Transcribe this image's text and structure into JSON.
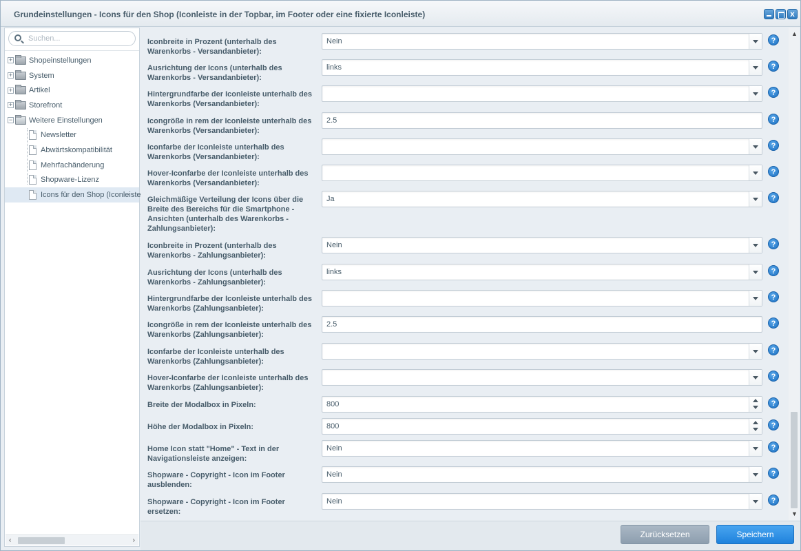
{
  "window": {
    "title": "Grundeinstellungen - Icons für den Shop (Iconleiste in der Topbar, im Footer oder eine fixierte Iconleiste)",
    "close_glyph": "x"
  },
  "sidebar": {
    "search_placeholder": "Suchen...",
    "expand_glyph": "+",
    "collapse_glyph": "−",
    "tree": [
      {
        "label": "Shopeinstellungen",
        "icon": "folder-icon",
        "expanded": false
      },
      {
        "label": "System",
        "icon": "folder-icon",
        "expanded": false
      },
      {
        "label": "Artikel",
        "icon": "folder-icon",
        "expanded": false
      },
      {
        "label": "Storefront",
        "icon": "folder-icon",
        "expanded": false
      },
      {
        "label": "Weitere Einstellungen",
        "icon": "folder-open-icon",
        "expanded": true
      },
      {
        "label": "Newsletter",
        "icon": "document-icon"
      },
      {
        "label": "Abwärtskompatibilität",
        "icon": "document-icon"
      },
      {
        "label": "Mehrfachänderung",
        "icon": "document-icon"
      },
      {
        "label": "Shopware-Lizenz",
        "icon": "document-icon"
      },
      {
        "label": "Icons für den Shop (Iconleiste",
        "icon": "document-icon",
        "selected": true
      }
    ]
  },
  "form": {
    "help_glyph": "?",
    "fields": [
      {
        "label": "Iconbreite in Prozent (unterhalb des Warenkorbs - Versandanbieter):",
        "type": "select",
        "value": "Nein"
      },
      {
        "label": "Ausrichtung der Icons (unterhalb des Warenkorbs - Versandanbieter):",
        "type": "select",
        "value": "links"
      },
      {
        "label": "Hintergrundfarbe der Iconleiste unterhalb des Warenkorbs (Versandanbieter):",
        "type": "select",
        "value": ""
      },
      {
        "label": "Icongröße in rem der Iconleiste unterhalb des Warenkorbs (Versandanbieter):",
        "type": "text",
        "value": "2.5"
      },
      {
        "label": "Iconfarbe der Iconleiste unterhalb des Warenkorbs (Versandanbieter):",
        "type": "select",
        "value": ""
      },
      {
        "label": "Hover-Iconfarbe der Iconleiste unterhalb des Warenkorbs (Versandanbieter):",
        "type": "select",
        "value": ""
      },
      {
        "label": "Gleichmäßige Verteilung der Icons über die Breite des Bereichs für die Smartphone - Ansichten (unterhalb des Warenkorbs - Zahlungsanbieter):",
        "type": "select",
        "value": "Ja"
      },
      {
        "label": "Iconbreite in Prozent (unterhalb des Warenkorbs - Zahlungsanbieter):",
        "type": "select",
        "value": "Nein"
      },
      {
        "label": "Ausrichtung der Icons (unterhalb des Warenkorbs - Zahlungsanbieter):",
        "type": "select",
        "value": "links"
      },
      {
        "label": "Hintergrundfarbe der Iconleiste unterhalb des Warenkorbs (Zahlungsanbieter):",
        "type": "select",
        "value": ""
      },
      {
        "label": "Icongröße in rem der Iconleiste unterhalb des Warenkorbs (Zahlungsanbieter):",
        "type": "text",
        "value": "2.5"
      },
      {
        "label": "Iconfarbe der Iconleiste unterhalb des Warenkorbs (Zahlungsanbieter):",
        "type": "select",
        "value": ""
      },
      {
        "label": "Hover-Iconfarbe der Iconleiste unterhalb des Warenkorbs (Zahlungsanbieter):",
        "type": "select",
        "value": ""
      },
      {
        "label": "Breite der Modalbox in Pixeln:",
        "type": "number",
        "value": "800"
      },
      {
        "label": "Höhe der Modalbox in Pixeln:",
        "type": "number",
        "value": "800"
      },
      {
        "label": "Home Icon statt \"Home\" - Text in der Navigationsleiste anzeigen:",
        "type": "select",
        "value": "Nein"
      },
      {
        "label": "Shopware - Copyright - Icon im Footer ausblenden:",
        "type": "select",
        "value": "Nein"
      },
      {
        "label": "Shopware - Copyright - Icon im Footer ersetzen:",
        "type": "select",
        "value": "Nein"
      }
    ]
  },
  "footer": {
    "reset_label": "Zurücksetzen",
    "save_label": "Speichern"
  },
  "colors": {
    "primary_button": "#2b8ae0",
    "secondary_button": "#9aaab9",
    "help_icon": "#1b73c8"
  }
}
